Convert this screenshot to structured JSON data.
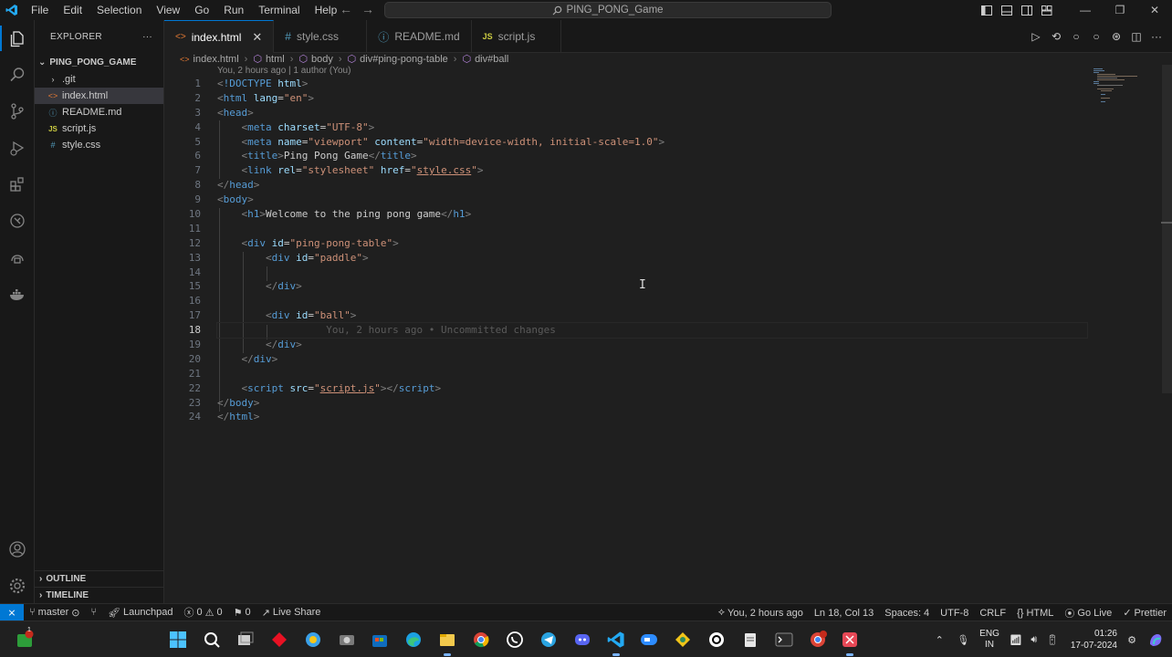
{
  "menu": [
    "File",
    "Edit",
    "Selection",
    "View",
    "Go",
    "Run",
    "Terminal",
    "Help"
  ],
  "command_center": {
    "text": "PING_PONG_Game",
    "icon": "search-icon"
  },
  "explorer": {
    "title": "EXPLORER",
    "folder": "PING_PONG_GAME",
    "files": [
      {
        "name": ".git",
        "kind": "folder"
      },
      {
        "name": "index.html",
        "kind": "html"
      },
      {
        "name": "README.md",
        "kind": "md"
      },
      {
        "name": "script.js",
        "kind": "js"
      },
      {
        "name": "style.css",
        "kind": "css"
      }
    ],
    "outline": "OUTLINE",
    "timeline": "TIMELINE"
  },
  "tabs": [
    {
      "label": "index.html",
      "icon": "<>"
    },
    {
      "label": "style.css",
      "icon": "#"
    },
    {
      "label": "README.md",
      "icon": "ⓘ"
    },
    {
      "label": "script.js",
      "icon": "JS"
    }
  ],
  "breadcrumb": [
    "index.html",
    "html",
    "body",
    "div#ping-pong-table",
    "div#ball"
  ],
  "codelens": "You, 2 hours ago | 1 author (You)",
  "code": {
    "line_numbers": [
      "1",
      "2",
      "3",
      "4",
      "5",
      "6",
      "7",
      "8",
      "9",
      "10",
      "11",
      "12",
      "13",
      "14",
      "15",
      "16",
      "17",
      "18",
      "19",
      "20",
      "21",
      "22",
      "23",
      "24"
    ],
    "current_line": "18",
    "blame_hint": "You, 2 hours ago • Uncommitted changes",
    "doctype": "!DOCTYPE",
    "html_kw": "html",
    "html": "html",
    "lang_attr": "lang",
    "lang_val": "\"en\"",
    "head": "head",
    "meta": "meta",
    "charset_attr": "charset",
    "charset_val": "\"UTF-8\"",
    "name_attr": "name",
    "name_val": "\"viewport\"",
    "content_attr": "content",
    "content_val": "\"width=device-width, initial-scale=1.0\"",
    "title": "title",
    "title_text": "Ping Pong Game",
    "link": "link",
    "rel_attr": "rel",
    "rel_val": "\"stylesheet\"",
    "href_attr": "href",
    "href_val": "style.css",
    "body": "body",
    "h1": "h1",
    "h1_text": "Welcome to the ping pong game",
    "div": "div",
    "id_attr": "id",
    "table_id": "\"ping-pong-table\"",
    "paddle_id": "\"paddle\"",
    "ball_id": "\"ball\"",
    "script": "script",
    "src_attr": "src",
    "src_val": "script.js"
  },
  "status": {
    "branch": "master",
    "launchpad": "Launchpad",
    "errors": "0",
    "warnings": "0",
    "ports": "0",
    "live_share": "Live Share",
    "blame": "You, 2 hours ago",
    "position": "Ln 18, Col 13",
    "spaces": "Spaces: 4",
    "encoding": "UTF-8",
    "eol": "CRLF",
    "language": "HTML",
    "go_live": "Go Live",
    "prettier": "Prettier"
  },
  "taskbar": {
    "lang_line1": "ENG",
    "lang_line2": "IN",
    "time": "01:26",
    "date": "17-07-2024",
    "badge": "1"
  },
  "colors": {
    "accent": "#0078d4",
    "tag": "#569cd6",
    "attr": "#9cdcfe",
    "string": "#ce9178"
  }
}
